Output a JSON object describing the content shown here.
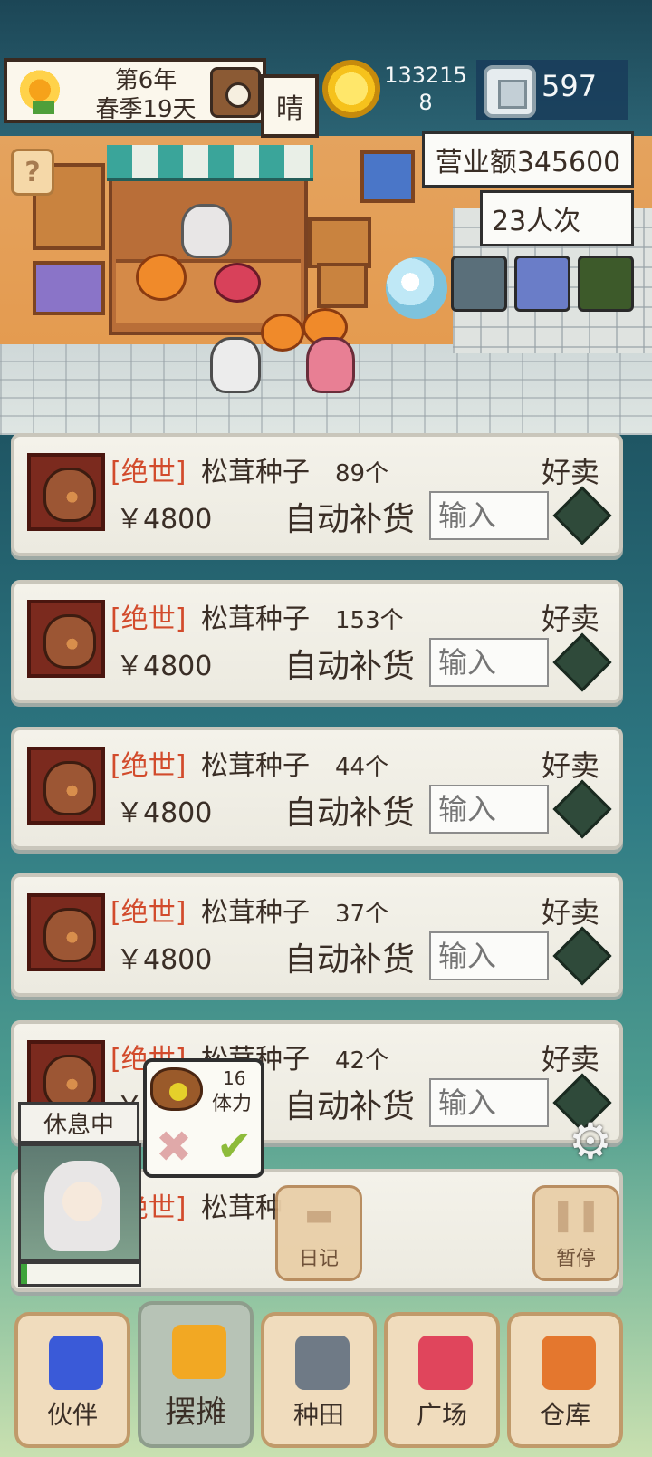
{
  "hud": {
    "date_year": "第6年",
    "date_season": "春季19天",
    "weather": "晴",
    "coins": "133215\n8",
    "gems": "597",
    "revenue": "营业额345600",
    "visitors": "23人次",
    "help_glyph": "?"
  },
  "goods": [
    {
      "grade": "[绝世]",
      "name": "松茸种子",
      "qty": "89个",
      "hot": "好卖",
      "price": "￥4800",
      "auto_restock": "自动补货",
      "input_placeholder": "输入"
    },
    {
      "grade": "[绝世]",
      "name": "松茸种子",
      "qty": "153个",
      "hot": "好卖",
      "price": "￥4800",
      "auto_restock": "自动补货",
      "input_placeholder": "输入"
    },
    {
      "grade": "[绝世]",
      "name": "松茸种子",
      "qty": "44个",
      "hot": "好卖",
      "price": "￥4800",
      "auto_restock": "自动补货",
      "input_placeholder": "输入"
    },
    {
      "grade": "[绝世]",
      "name": "松茸种子",
      "qty": "37个",
      "hot": "好卖",
      "price": "￥4800",
      "auto_restock": "自动补货",
      "input_placeholder": "输入"
    },
    {
      "grade": "[绝世]",
      "name": "松茸种子",
      "qty": "42个",
      "hot": "好卖",
      "price": "￥4800",
      "auto_restock": "自动补货",
      "input_placeholder": "输入"
    },
    {
      "grade": "[绝世]",
      "name": "松茸种",
      "qty": "",
      "hot": "",
      "price": "",
      "auto_restock": "",
      "input_placeholder": ""
    }
  ],
  "companion": {
    "status": "休息中",
    "stamina_fraction": 0.05
  },
  "popup": {
    "stamina_amount": "16",
    "stamina_label": "体力",
    "cancel_glyph": "✖",
    "confirm_glyph": "✔"
  },
  "buttons": {
    "diary": "日记",
    "pause": "暂停",
    "settings_glyph": "⚙"
  },
  "nav": [
    {
      "label": "伙伴",
      "icon": "flower-icon",
      "color": "#3a5ad8"
    },
    {
      "label": "摆摊",
      "icon": "coins-icon",
      "color": "#f2a823"
    },
    {
      "label": "种田",
      "icon": "watering-can-icon",
      "color": "#6f7a86"
    },
    {
      "label": "广场",
      "icon": "flower-icon",
      "color": "#e0455c"
    },
    {
      "label": "仓库",
      "icon": "house-icon",
      "color": "#e4772e"
    }
  ]
}
